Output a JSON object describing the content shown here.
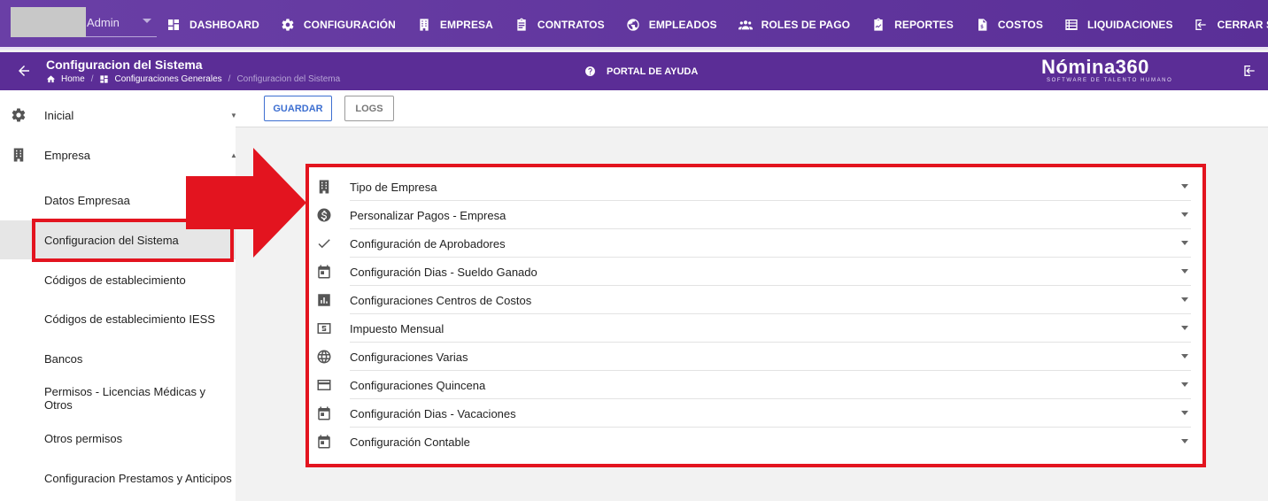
{
  "top_nav": {
    "user_name": "Admin",
    "items": [
      {
        "label": "DASHBOARD",
        "icon": "dashboard-icon"
      },
      {
        "label": "CONFIGURACIÓN",
        "icon": "gear-icon"
      },
      {
        "label": "EMPRESA",
        "icon": "building-icon"
      },
      {
        "label": "CONTRATOS",
        "icon": "clipboard-icon"
      },
      {
        "label": "EMPLEADOS",
        "icon": "globe-icon"
      },
      {
        "label": "ROLES DE PAGO",
        "icon": "group-icon"
      },
      {
        "label": "REPORTES",
        "icon": "report-icon"
      },
      {
        "label": "COSTOS",
        "icon": "invoice-icon"
      },
      {
        "label": "LIQUIDACIONES",
        "icon": "list-icon"
      },
      {
        "label": "CERRAR SESIÓN",
        "icon": "logout-icon"
      }
    ]
  },
  "sub_header": {
    "title": "Configuracion del Sistema",
    "breadcrumb": [
      "Home",
      "Configuraciones Generales",
      "Configuracion del Sistema"
    ],
    "help_label": "PORTAL DE AYUDA",
    "logo_main": "Nómina360",
    "logo_sub": "SOFTWARE DE TALENTO HUMANO"
  },
  "sidebar": {
    "groups": [
      {
        "label": "Inicial",
        "icon": "gear-icon",
        "expanded": false
      },
      {
        "label": "Empresa",
        "icon": "building-icon",
        "expanded": true
      }
    ],
    "items": [
      {
        "label": "Datos Empresaa"
      },
      {
        "label": "Configuracion del Sistema",
        "active": true
      },
      {
        "label": "Códigos de establecimiento"
      },
      {
        "label": "Códigos de establecimiento IESS"
      },
      {
        "label": "Bancos"
      },
      {
        "label": "Permisos - Licencias Médicas y Otros"
      },
      {
        "label": "Otros permisos"
      },
      {
        "label": "Configuracion Prestamos y Anticipos"
      }
    ]
  },
  "toolbar": {
    "save_label": "GUARDAR",
    "logs_label": "LOGS"
  },
  "accordion": [
    {
      "label": "Tipo de Empresa",
      "icon": "building-icon"
    },
    {
      "label": "Personalizar Pagos - Empresa",
      "icon": "dollar-icon"
    },
    {
      "label": "Configuración de Aprobadores",
      "icon": "check-icon"
    },
    {
      "label": "Configuración Dias - Sueldo Ganado",
      "icon": "calendar-icon"
    },
    {
      "label": "Configuraciones Centros de Costos",
      "icon": "bar-chart-icon"
    },
    {
      "label": "Impuesto Mensual",
      "icon": "money-icon"
    },
    {
      "label": "Configuraciones Varias",
      "icon": "globe-icon"
    },
    {
      "label": "Configuraciones Quincena",
      "icon": "card-icon"
    },
    {
      "label": "Configuración Dias - Vacaciones",
      "icon": "calendar-icon"
    },
    {
      "label": "Configuración Contable",
      "icon": "calendar-icon"
    }
  ],
  "colors": {
    "nav_bg": "#6a3fa6",
    "subheader_bg": "#5b2d96",
    "annotation_red": "#e3141f",
    "primary_blue": "#3d6fd1"
  }
}
